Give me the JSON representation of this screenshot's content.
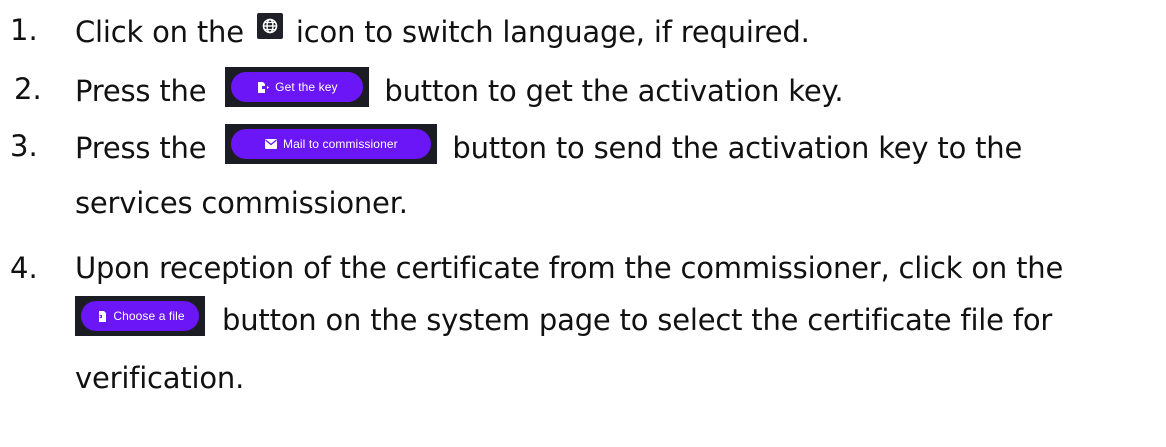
{
  "steps": [
    {
      "number": "1.",
      "before": "Click on the",
      "icon": "globe-icon",
      "after": "icon to switch language, if required."
    },
    {
      "number": "2.",
      "before": "Press the",
      "button": {
        "label": "Get the key",
        "icon": "file-export-icon"
      },
      "after": "button to get the activation key."
    },
    {
      "number": "3.",
      "before": "Press the",
      "button": {
        "label": "Mail to commissioner",
        "icon": "envelope-icon"
      },
      "after": "button to send the activation key to the",
      "continuation": "services commissioner."
    },
    {
      "number": "4.",
      "before": "Upon reception of the certificate from the commissioner, click on the",
      "button": {
        "label": "Choose a file",
        "icon": "file-import-icon"
      },
      "after": "button on the system page to select the certificate file for",
      "continuation": "verification."
    }
  ],
  "colors": {
    "button_bg": "#6a16f6",
    "frame_bg": "#1c1c24",
    "text": "#111111"
  }
}
